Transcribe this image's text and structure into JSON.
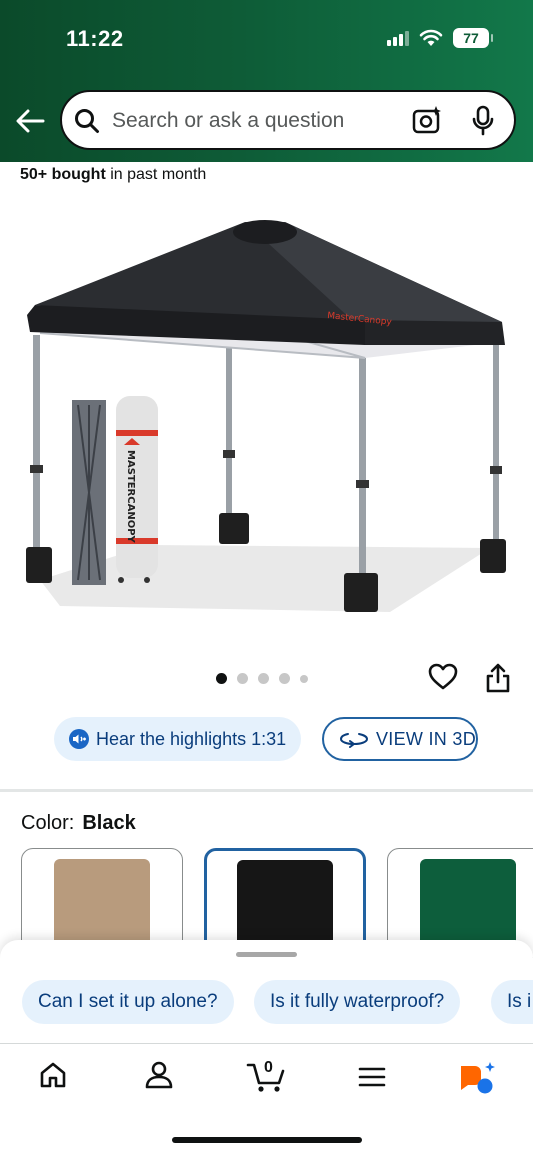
{
  "status_bar": {
    "time": "11:22",
    "battery": "77"
  },
  "search": {
    "placeholder": "Search or ask a question"
  },
  "product": {
    "bought_bold": "50+ bought",
    "bought_rest": " in past month",
    "image_count": 5,
    "active_image": 1,
    "brand_on_bag": "MASTERCANOPY"
  },
  "actions": {
    "hear_label": "Hear the highlights 1:31",
    "view3d_label": "VIEW IN 3D"
  },
  "color": {
    "label": "Color:",
    "selected": "Black",
    "swatches": [
      {
        "name": "Beige",
        "hex": "#b89b7d"
      },
      {
        "name": "Black",
        "hex": "#161616"
      },
      {
        "name": "Green",
        "hex": "#0d5e3c"
      }
    ]
  },
  "questions": [
    "Can I set it up alone?",
    "Is it fully waterproof?",
    "Is i"
  ],
  "nav": {
    "cart_count": "0"
  },
  "colors": {
    "header_green": "#0e5c37",
    "link_blue": "#0a3d7c",
    "chip_bg": "#e5f1fc",
    "accent_orange": "#ff6600",
    "accent_blue": "#1a73e8"
  }
}
